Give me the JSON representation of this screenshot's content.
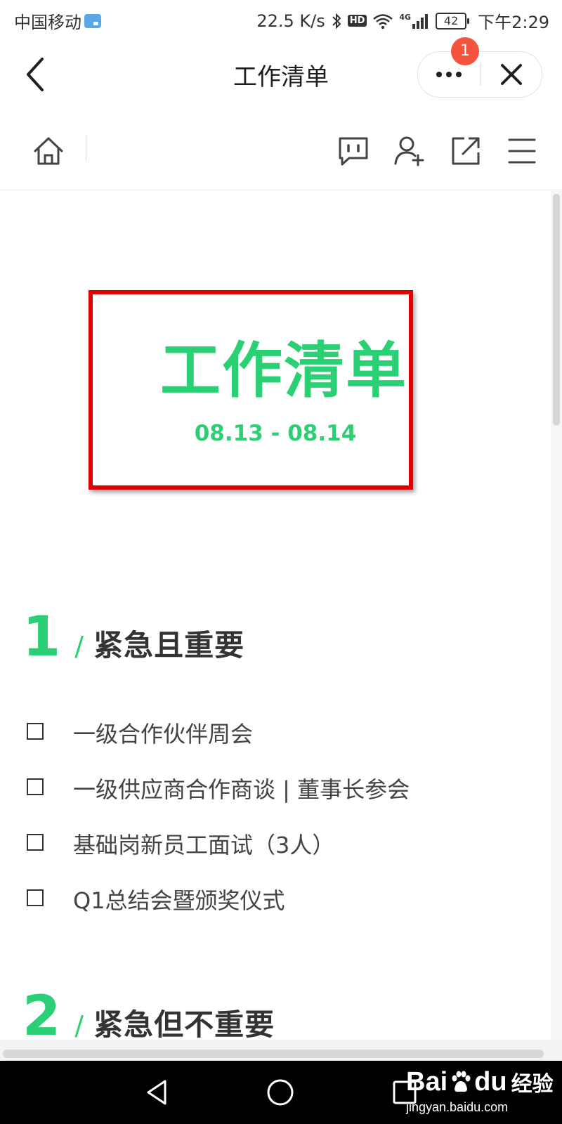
{
  "status_bar": {
    "carrier": "中国移动",
    "speed": "22.5 K/s",
    "hd": "HD",
    "network": "4G",
    "battery": "42",
    "time": "下午2:29"
  },
  "nav": {
    "title": "工作清单",
    "badge_count": "1"
  },
  "toolbar": {
    "icons": [
      "home-icon",
      "comment-icon",
      "add-user-icon",
      "share-icon",
      "menu-icon"
    ]
  },
  "cover": {
    "title": "工作清单",
    "date": "08.13 - 08.14",
    "accent_color": "#2bd075",
    "border_color": "#e00000"
  },
  "sections": [
    {
      "number": "1",
      "slash": "/",
      "title": "紧急且重要",
      "items": [
        {
          "label": "一级合作伙伴周会",
          "checked": false
        },
        {
          "label": "一级供应商合作商谈 | 董事长参会",
          "checked": false
        },
        {
          "label": "基础岗新员工面试（3人）",
          "checked": false
        },
        {
          "label": "Q1总结会暨颁奖仪式",
          "checked": false
        }
      ]
    },
    {
      "number": "2",
      "slash": "/",
      "title": "紧急但不重要"
    }
  ],
  "watermark": {
    "brand_latin_1": "Bai",
    "brand_latin_2": "du",
    "brand_cn": "经验",
    "url": "jingyan.baidu.com"
  }
}
